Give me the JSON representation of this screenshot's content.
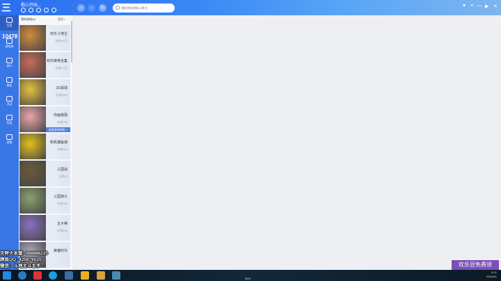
{
  "window": {
    "logo_text": "三",
    "title": "歌心开始...",
    "search_placeholder": "搜索游戏(例如斗地主)",
    "controls": [
      "♥",
      "≡",
      "—",
      "▶",
      "✕"
    ]
  },
  "sidebar": {
    "score": "10478",
    "items": [
      {
        "label": "主页",
        "icon": "home-icon"
      },
      {
        "label": "游戏库",
        "icon": "gamepad-icon"
      },
      {
        "label": "排行",
        "icon": "trophy-icon"
      },
      {
        "label": "商店",
        "icon": "shop-icon"
      },
      {
        "label": "活动",
        "icon": "gift-icon"
      },
      {
        "label": "任务",
        "icon": "task-icon"
      },
      {
        "label": "宠物",
        "icon": "pet-icon"
      }
    ]
  },
  "list": {
    "header": "我的游戏(9)",
    "manage": "管理 >",
    "games": [
      {
        "name": "欢乐斗地主",
        "sub": "在线4.6万",
        "color": "#d08a3c"
      },
      {
        "name": "欢乐麻将全集",
        "sub": "在线1.2万",
        "color": "#c96a5a"
      },
      {
        "name": "2D桌球",
        "sub": "在线9993",
        "color": "#e6c040"
      },
      {
        "name": "你画我猜",
        "sub": "在线785",
        "color": "#e9a6a6",
        "more": "查看游戏特权 >"
      },
      {
        "name": "街机捕鱼城",
        "sub": "在线359",
        "color": "#e0c01c"
      },
      {
        "name": "三国战",
        "sub": "在线92",
        "color": "#6a5a3c"
      },
      {
        "name": "三国演义",
        "sub": "在线335",
        "color": "#8aa070"
      },
      {
        "name": "五子棋",
        "sub": "在线668",
        "color": "#8a70c0"
      },
      {
        "name": "英雄时代",
        "sub": "",
        "color": "#b0a8c0"
      }
    ]
  },
  "overlay": {
    "lines": [
      "天秤大本营: 088888225",
      "牌局QQ: 425876025",
      "微信：斗地主斗主手"
    ]
  },
  "promo": "欢乐豆免费领",
  "taskbar": {
    "percent": "36%",
    "time": "8:31",
    "date": "2020/6/1"
  }
}
